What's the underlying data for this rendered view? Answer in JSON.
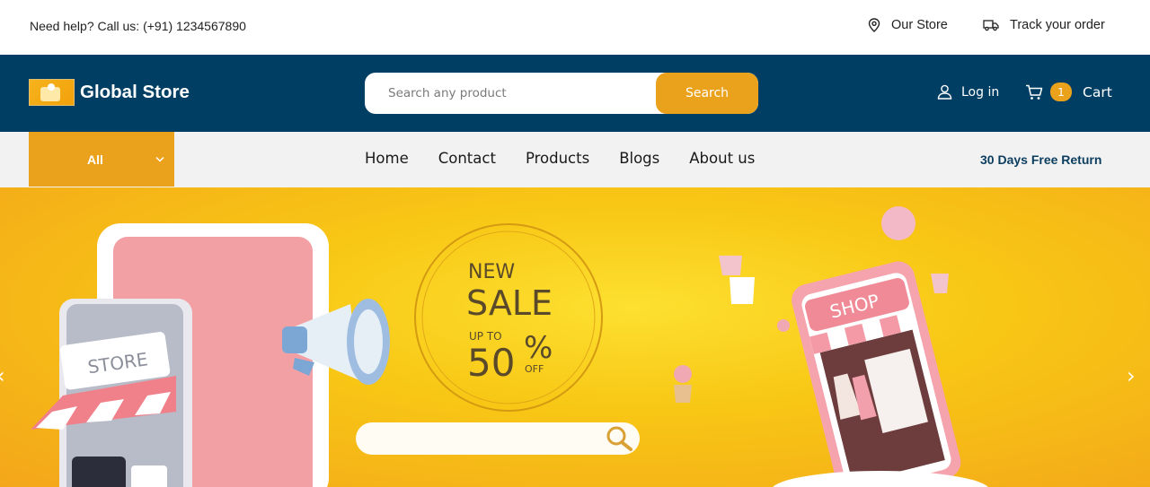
{
  "topbar": {
    "help_text": "Need help? Call us: (+91) 1234567890",
    "store_label": "Our Store",
    "track_label": "Track your order",
    "store_icon": "map-pin-icon",
    "track_icon": "truck-icon"
  },
  "header": {
    "brand_name": "Global Store",
    "search_placeholder": "Search any product",
    "search_button": "Search",
    "login_label": "Log in",
    "cart_count": "1",
    "cart_label": "Cart"
  },
  "nav": {
    "category_label": "All",
    "links": [
      "Home",
      "Contact",
      "Products",
      "Blogs",
      "About us"
    ],
    "promo": "30 Days Free Return"
  },
  "hero": {
    "banner_text": {
      "line1": "NEW",
      "line2": "SALE",
      "upto": "UP TO",
      "value": "50",
      "percent": "%",
      "off": "OFF",
      "store_sign": "STORE",
      "shop_sign": "SHOP"
    },
    "prev_arrow": "‹",
    "next_arrow": "›"
  },
  "colors": {
    "header_bg": "#003f63",
    "accent": "#eaa21c",
    "nav_bg": "#f2f2f2",
    "promo_text": "#0b3d5f"
  }
}
